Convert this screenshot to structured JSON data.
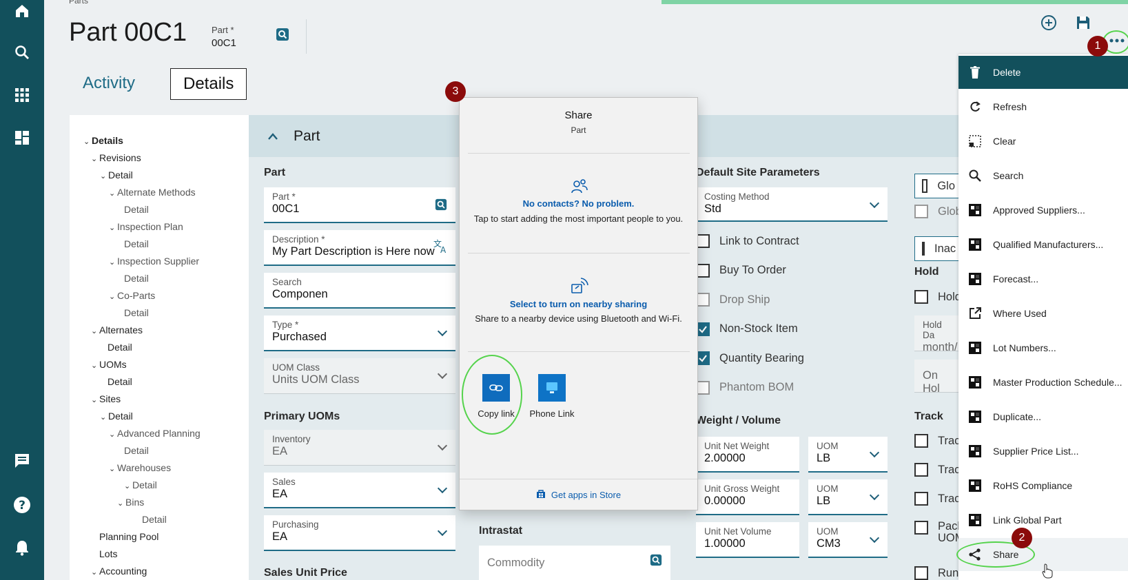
{
  "breadcrumb": "Parts",
  "page": {
    "title": "Part 00C1",
    "header_field_label": "Part *",
    "header_field_value": "00C1"
  },
  "tabs": [
    {
      "label": "Activity"
    },
    {
      "label": "Details"
    }
  ],
  "tree": [
    {
      "label": "Details",
      "bold": true
    },
    {
      "label": "Revisions"
    },
    {
      "label": "Detail"
    },
    {
      "label": "Alternate Methods"
    },
    {
      "label": "Detail"
    },
    {
      "label": "Inspection Plan"
    },
    {
      "label": "Detail"
    },
    {
      "label": "Inspection Supplier"
    },
    {
      "label": "Detail"
    },
    {
      "label": "Co-Parts"
    },
    {
      "label": "Detail"
    },
    {
      "label": "Alternates"
    },
    {
      "label": "Detail"
    },
    {
      "label": "UOMs"
    },
    {
      "label": "Detail"
    },
    {
      "label": "Sites"
    },
    {
      "label": "Detail"
    },
    {
      "label": "Advanced Planning"
    },
    {
      "label": "Detail"
    },
    {
      "label": "Warehouses"
    },
    {
      "label": "Detail"
    },
    {
      "label": "Bins"
    },
    {
      "label": "Detail"
    },
    {
      "label": "Planning Pool"
    },
    {
      "label": "Lots"
    },
    {
      "label": "Accounting"
    }
  ],
  "section": {
    "title": "Part"
  },
  "part_group": {
    "label": "Part",
    "fields": [
      {
        "label": "Part *",
        "value": "00C1"
      },
      {
        "label": "Description *",
        "value": "My Part Description is Here now"
      },
      {
        "label": "Search",
        "value": "Componen"
      },
      {
        "label": "Type *",
        "value": "Purchased"
      },
      {
        "label": "UOM Class",
        "value": "Units UOM Class"
      }
    ]
  },
  "primary_uoms": {
    "label": "Primary UOMs",
    "fields": [
      {
        "label": "Inventory",
        "value": "EA"
      },
      {
        "label": "Sales",
        "value": "EA"
      },
      {
        "label": "Purchasing",
        "value": "EA"
      }
    ]
  },
  "sales_unit_price_label": "Sales Unit Price",
  "intrastat": {
    "label": "Intrastat",
    "commodity_placeholder": "Commodity"
  },
  "default_site": {
    "label": "Default Site Parameters",
    "costing_label": "Costing Method",
    "costing_value": "Std",
    "checks": [
      {
        "label": "Link to Contract",
        "checked": false,
        "muted": false
      },
      {
        "label": "Buy To Order",
        "checked": false,
        "muted": false
      },
      {
        "label": "Drop Ship",
        "checked": false,
        "muted": true
      },
      {
        "label": "Non-Stock Item",
        "checked": true,
        "muted": false
      },
      {
        "label": "Quantity Bearing",
        "checked": true,
        "muted": false
      },
      {
        "label": "Phantom BOM",
        "checked": false,
        "muted": true
      }
    ]
  },
  "weight_volume": {
    "label": "Weight / Volume",
    "rows": [
      {
        "label": "Unit Net Weight",
        "value": "2.00000",
        "uom_label": "UOM",
        "uom": "LB"
      },
      {
        "label": "Unit Gross Weight",
        "value": "0.00000",
        "uom_label": "UOM",
        "uom": "LB"
      },
      {
        "label": "Unit Net Volume",
        "value": "1.00000",
        "uom_label": "UOM",
        "uom": "CM3"
      }
    ]
  },
  "right_col": {
    "glob1": "Glo",
    "glob2": "Glob",
    "inac": "Inac",
    "hold_label": "Hold",
    "hold_check": "Hold",
    "hold_date_label": "Hold Da",
    "hold_date_value": "month/",
    "on_hold": "On Hol",
    "track_label": "Track",
    "track1": "Trac",
    "track2": "Trac",
    "track3": "Trac",
    "pack1": "Pack",
    "pack2": "UOM",
    "run": "Run"
  },
  "menu": {
    "items": [
      {
        "label": "Delete",
        "icon": "trash-icon"
      },
      {
        "label": "Refresh",
        "icon": "refresh-icon"
      },
      {
        "label": "Clear",
        "icon": "clear-icon"
      },
      {
        "label": "Search",
        "icon": "search-icon"
      },
      {
        "label": "Approved Suppliers...",
        "icon": "form-icon"
      },
      {
        "label": "Qualified Manufacturers...",
        "icon": "form-icon"
      },
      {
        "label": "Forecast...",
        "icon": "form-icon"
      },
      {
        "label": "Where Used",
        "icon": "open-external-icon"
      },
      {
        "label": "Lot Numbers...",
        "icon": "form-icon"
      },
      {
        "label": "Master Production Schedule...",
        "icon": "form-icon"
      },
      {
        "label": "Duplicate...",
        "icon": "form-icon"
      },
      {
        "label": "Supplier Price List...",
        "icon": "form-icon"
      },
      {
        "label": "RoHS Compliance",
        "icon": "form-icon"
      },
      {
        "label": "Link Global Part",
        "icon": "form-icon"
      },
      {
        "label": "Share",
        "icon": "share-icon"
      }
    ]
  },
  "share_panel": {
    "title": "Share",
    "subtitle": "Part",
    "no_contacts_title": "No contacts? No problem.",
    "no_contacts_text": "Tap to start adding the most important people to you.",
    "nearby_title": "Select to turn on nearby sharing",
    "nearby_text": "Share to a nearby device using Bluetooth and Wi-Fi.",
    "apps": [
      {
        "label": "Copy link"
      },
      {
        "label": "Phone Link"
      }
    ],
    "footer": "Get apps in Store"
  },
  "markers": [
    "1",
    "2",
    "3"
  ],
  "colors": {
    "sidebar": "#12505c",
    "accent": "#1e6b86",
    "marker": "#8b0b0b",
    "highlight_ring": "#55d34c",
    "link": "#0a5cad"
  }
}
